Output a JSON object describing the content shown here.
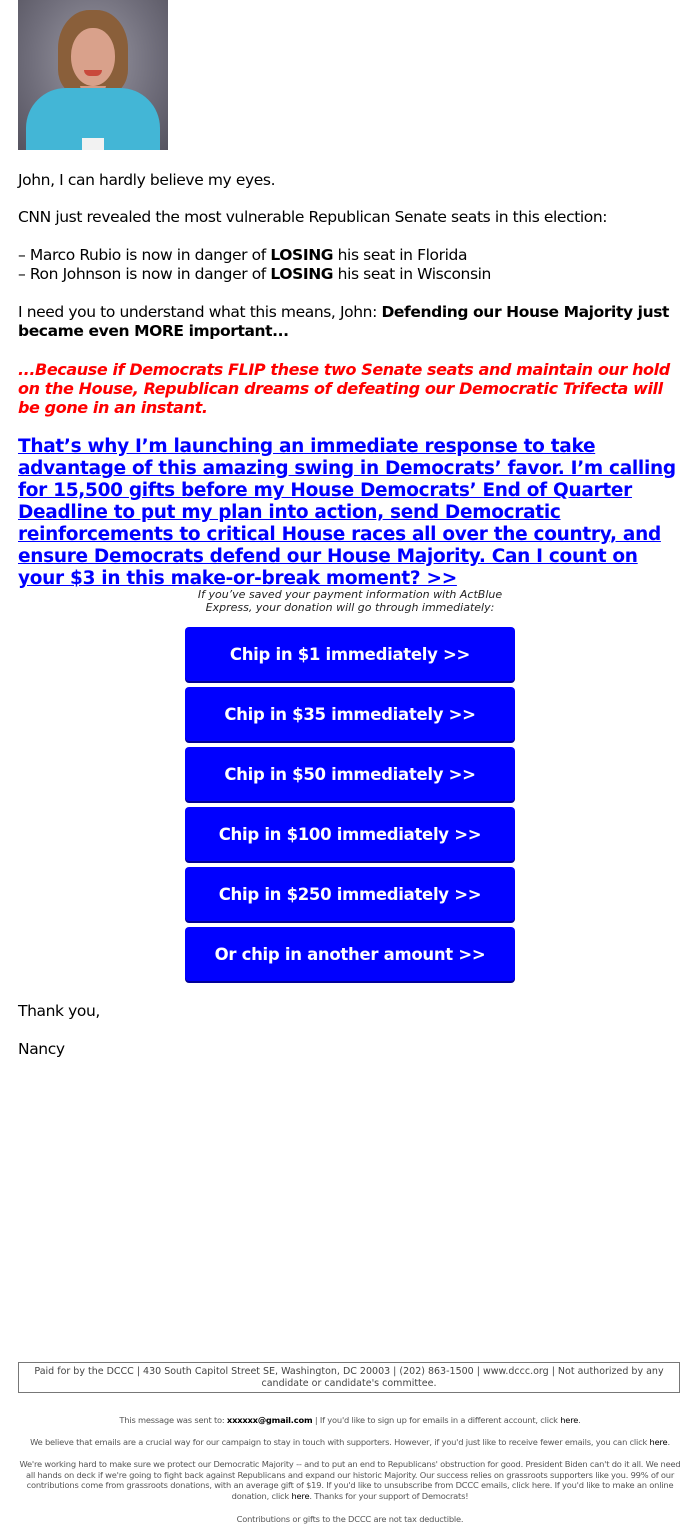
{
  "photo": {
    "alt": "Portrait of Nancy"
  },
  "greeting": "John, I can hardly believe my eyes.",
  "intro": "CNN just revealed the most vulnerable Republican Senate seats in this election:",
  "list": [
    {
      "pre": "– Marco Rubio is now in danger of ",
      "bold": "LOSING",
      "post": " his seat in Florida"
    },
    {
      "pre": "– Ron Johnson is now in danger of ",
      "bold": "LOSING",
      "post": " his seat in Wisconsin"
    }
  ],
  "need": {
    "pre": "I need you to understand what this means, John: ",
    "bold": "Defending our House Majority just became even MORE important..."
  },
  "red_text": "...Because if Democrats FLIP these two Senate seats and maintain our hold on the House, Republican dreams of defeating our Democratic Trifecta will be gone in an instant.",
  "cta_link": "That’s why I’m launching an immediate response to take advantage of this amazing swing in Democrats’ favor. I’m calling for 15,500 gifts before my House Democrats’ End of Quarter Deadline to put my plan into action, send Democratic reinforcements to critical House races all over the country, and ensure Democrats defend our House Majority. Can I count on your $3 in this make-or-break moment? >>",
  "express_note": "If you’ve saved your payment information with ActBlue Express, your donation will go through immediately:",
  "buttons": [
    {
      "label": "Chip in $1 immediately >>"
    },
    {
      "label": "Chip in $35 immediately >>"
    },
    {
      "label": "Chip in $50 immediately >>"
    },
    {
      "label": "Chip in $100 immediately >>"
    },
    {
      "label": "Chip in $250 immediately >>"
    },
    {
      "label": "Or chip in another amount >>"
    }
  ],
  "colors": {
    "button": "#0000ff",
    "red": "#ff0000",
    "link": "#0000ff"
  },
  "signoff": "Thank you,",
  "signature": "Nancy",
  "disclaimer": "Paid for by the DCCC | 430 South Capitol Street SE, Washington, DC 20003 | (202) 863-1500 | www.dccc.org | Not authorized by any candidate or candidate's committee.",
  "footer": {
    "sent_pre": "This message was sent to: ",
    "sent_email": "xxxxxx@gmail.com",
    "sent_post": " | If you'd like to sign up for emails in a different account, click ",
    "here": "here",
    "fewer_pre": "We believe that emails are a crucial way for our campaign to stay in touch with supporters. However, if you'd just like to receive fewer emails, you can click ",
    "working_pre": "We're working hard to make sure we protect our Democratic Majority -- and to put an end to Republicans' obstruction for good. President Biden can't do it all. We need all hands on deck if we're going to fight back against Republicans and expand our historic Majority. Our success relies on grassroots supporters like you. 99% of our contributions come from grassroots donations, with an average gift of $19. If you'd like to unsubscribe from DCCC emails, click here. If you'd like to make an online donation, click ",
    "working_post": ". Thanks for your support of Democrats!",
    "tax": "Contributions or gifts to the DCCC are not tax deductible."
  }
}
